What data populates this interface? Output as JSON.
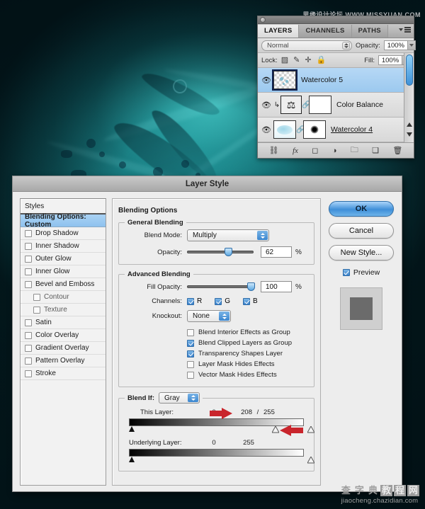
{
  "watermarks": {
    "top": "思缘设计论坛 WWW.MISSYUAN.COM",
    "bottom_cn": [
      "查",
      "字",
      "典",
      "教",
      "程",
      "网"
    ],
    "bottom_url": "jiaocheng.chazidian.com"
  },
  "layers_panel": {
    "tabs": [
      {
        "label": "LAYERS",
        "active": true
      },
      {
        "label": "CHANNELS",
        "active": false
      },
      {
        "label": "PATHS",
        "active": false
      }
    ],
    "blend_mode": "Normal",
    "opacity_label": "Opacity:",
    "opacity_value": "100%",
    "lock_label": "Lock:",
    "fill_label": "Fill:",
    "fill_value": "100%",
    "lock_icons": [
      "transparency-lock-icon",
      "brush-lock-icon",
      "move-lock-icon",
      "lock-all-icon"
    ],
    "layers": [
      {
        "name": "Watercolor 5",
        "selected": true,
        "kind": "pixel"
      },
      {
        "name": "Color Balance",
        "selected": false,
        "kind": "adjustment"
      },
      {
        "name": "Watercolor 4",
        "selected": false,
        "kind": "pixel-masked"
      }
    ],
    "toolbar_icons": [
      "link-layers-icon",
      "fx-icon",
      "layer-mask-icon",
      "adjustment-layer-icon",
      "new-group-icon",
      "new-layer-icon",
      "delete-layer-icon"
    ]
  },
  "dialog": {
    "title": "Layer Style",
    "styles_header": "Styles",
    "styles": [
      {
        "label": "Blending Options: Custom",
        "active": true,
        "checkbox": false,
        "indent": false
      },
      {
        "label": "Drop Shadow",
        "active": false,
        "checkbox": true,
        "checked": false,
        "indent": false
      },
      {
        "label": "Inner Shadow",
        "active": false,
        "checkbox": true,
        "checked": false,
        "indent": false
      },
      {
        "label": "Outer Glow",
        "active": false,
        "checkbox": true,
        "checked": false,
        "indent": false
      },
      {
        "label": "Inner Glow",
        "active": false,
        "checkbox": true,
        "checked": false,
        "indent": false
      },
      {
        "label": "Bevel and Emboss",
        "active": false,
        "checkbox": true,
        "checked": false,
        "indent": false
      },
      {
        "label": "Contour",
        "active": false,
        "checkbox": true,
        "checked": false,
        "indent": true
      },
      {
        "label": "Texture",
        "active": false,
        "checkbox": true,
        "checked": false,
        "indent": true
      },
      {
        "label": "Satin",
        "active": false,
        "checkbox": true,
        "checked": false,
        "indent": false
      },
      {
        "label": "Color Overlay",
        "active": false,
        "checkbox": true,
        "checked": false,
        "indent": false
      },
      {
        "label": "Gradient Overlay",
        "active": false,
        "checkbox": true,
        "checked": false,
        "indent": false
      },
      {
        "label": "Pattern Overlay",
        "active": false,
        "checkbox": true,
        "checked": false,
        "indent": false
      },
      {
        "label": "Stroke",
        "active": false,
        "checkbox": true,
        "checked": false,
        "indent": false
      }
    ],
    "blending_options_legend": "Blending Options",
    "general_blending": {
      "legend": "General Blending",
      "blend_mode_label": "Blend Mode:",
      "blend_mode_value": "Multiply",
      "opacity_label": "Opacity:",
      "opacity_value": "62",
      "opacity_unit": "%"
    },
    "advanced_blending": {
      "legend": "Advanced Blending",
      "fill_opacity_label": "Fill Opacity:",
      "fill_opacity_value": "100",
      "fill_opacity_unit": "%",
      "channels_label": "Channels:",
      "channels": [
        {
          "label": "R",
          "checked": true
        },
        {
          "label": "G",
          "checked": true
        },
        {
          "label": "B",
          "checked": true
        }
      ],
      "knockout_label": "Knockout:",
      "knockout_value": "None",
      "options": [
        {
          "label": "Blend Interior Effects as Group",
          "checked": false
        },
        {
          "label": "Blend Clipped Layers as Group",
          "checked": true
        },
        {
          "label": "Transparency Shapes Layer",
          "checked": true
        },
        {
          "label": "Layer Mask Hides Effects",
          "checked": false
        },
        {
          "label": "Vector Mask Hides Effects",
          "checked": false
        }
      ]
    },
    "blend_if": {
      "legend": "Blend If:",
      "channel_value": "Gray",
      "this_layer_label": "This Layer:",
      "this_layer_min": "0",
      "this_layer_max_a": "208",
      "this_layer_separator": "/",
      "this_layer_max_b": "255",
      "underlying_label": "Underlying Layer:",
      "underlying_min": "0",
      "underlying_max": "255"
    },
    "buttons": {
      "ok": "OK",
      "cancel": "Cancel",
      "new_style": "New Style...",
      "preview": "Preview"
    }
  },
  "colors": {
    "accent_blue": "#3a82cc",
    "selection_blue": "#9cc9ef",
    "arrow_red": "#c9252c",
    "dialog_bg": "#ededed",
    "artwork_teal": "#12565c"
  }
}
